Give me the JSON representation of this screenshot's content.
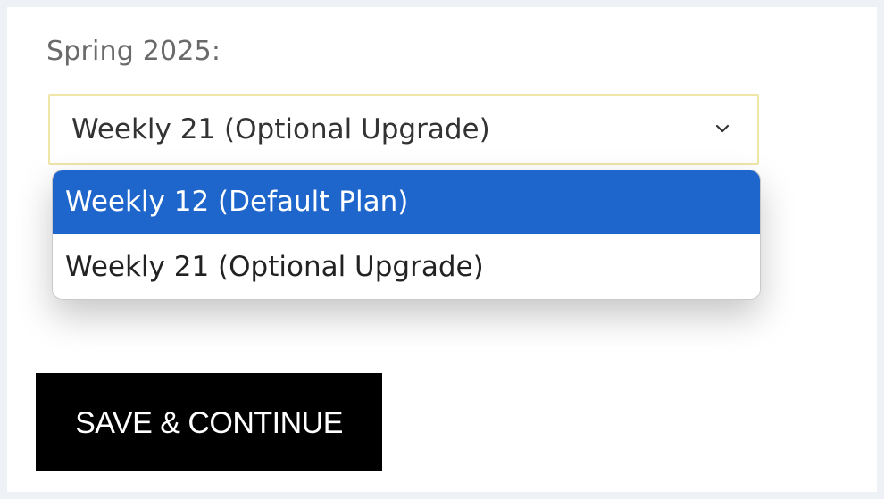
{
  "form": {
    "label": "Spring 2025:",
    "select": {
      "current_value": "Weekly 21 (Optional Upgrade)",
      "options": [
        {
          "label": "Weekly 12 (Default Plan)",
          "highlighted": true
        },
        {
          "label": "Weekly 21 (Optional Upgrade)",
          "highlighted": false
        }
      ],
      "icon": "chevron-down-icon"
    },
    "save_button_label": "SAVE & CONTINUE"
  },
  "colors": {
    "highlight": "#1e66cc",
    "button_bg": "#000000",
    "page_bg": "#eef2f7",
    "select_border": "#f0e6a8"
  }
}
